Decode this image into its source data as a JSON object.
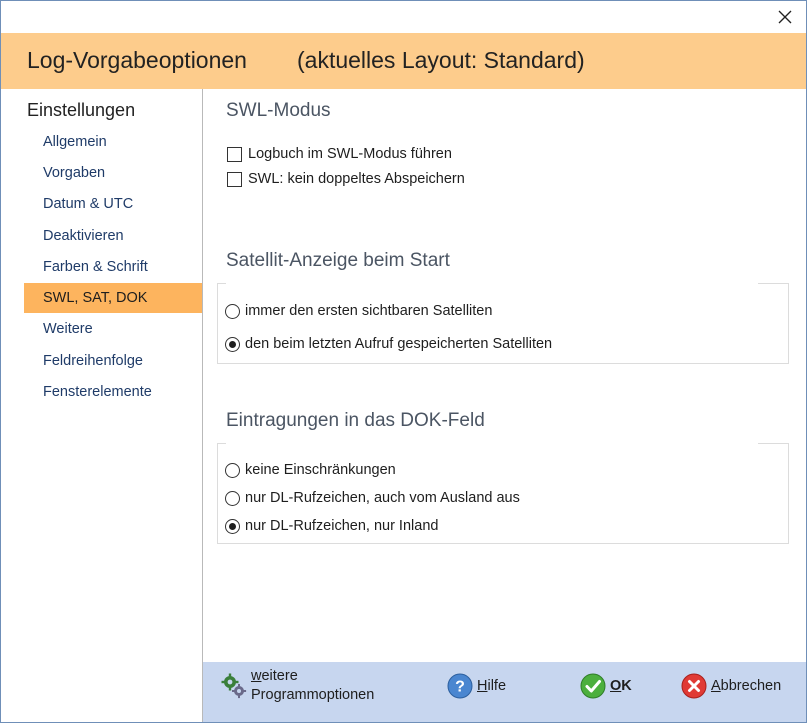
{
  "window": {
    "close_label": "×"
  },
  "header": {
    "title": "Log-Vorgabeoptionen",
    "layout_info": "(aktuelles Layout: Standard)"
  },
  "sidebar": {
    "heading": "Einstellungen",
    "items": [
      {
        "label": "Allgemein",
        "active": false
      },
      {
        "label": "Vorgaben",
        "active": false
      },
      {
        "label": "Datum & UTC",
        "active": false
      },
      {
        "label": "Deaktivieren",
        "active": false
      },
      {
        "label": "Farben & Schrift",
        "active": false
      },
      {
        "label": "SWL, SAT, DOK",
        "active": true
      },
      {
        "label": "Weitere",
        "active": false
      },
      {
        "label": "Feldreihenfolge",
        "active": false
      },
      {
        "label": "Fensterelemente",
        "active": false
      }
    ]
  },
  "swl": {
    "title": "SWL-Modus",
    "options": [
      {
        "label": "Logbuch im SWL-Modus führen",
        "checked": false
      },
      {
        "label": "SWL: kein doppeltes Abspeichern",
        "checked": false
      }
    ]
  },
  "satellit": {
    "title": "Satellit-Anzeige beim Start",
    "options": [
      {
        "label": "immer den ersten sichtbaren Satelliten",
        "checked": false
      },
      {
        "label": "den beim letzten Aufruf gespeicherten Satelliten",
        "checked": true
      }
    ]
  },
  "dok": {
    "title": "Eintragungen in das DOK-Feld",
    "options": [
      {
        "label": "keine Einschränkungen",
        "checked": false
      },
      {
        "label": "nur DL-Rufzeichen, auch vom Ausland aus",
        "checked": false
      },
      {
        "label": "nur DL-Rufzeichen, nur Inland",
        "checked": true
      }
    ]
  },
  "footer": {
    "more_options_line1": "weitere",
    "more_options_line2": "Programmoptionen",
    "help_label": "Hilfe",
    "ok_label": "OK",
    "cancel_label": "Abbrechen"
  },
  "colors": {
    "header_bg": "#fdcc8c",
    "active_item_bg": "#fdb45e",
    "footer_bg": "#c7d6ef",
    "nav_text": "#1f3b68"
  }
}
